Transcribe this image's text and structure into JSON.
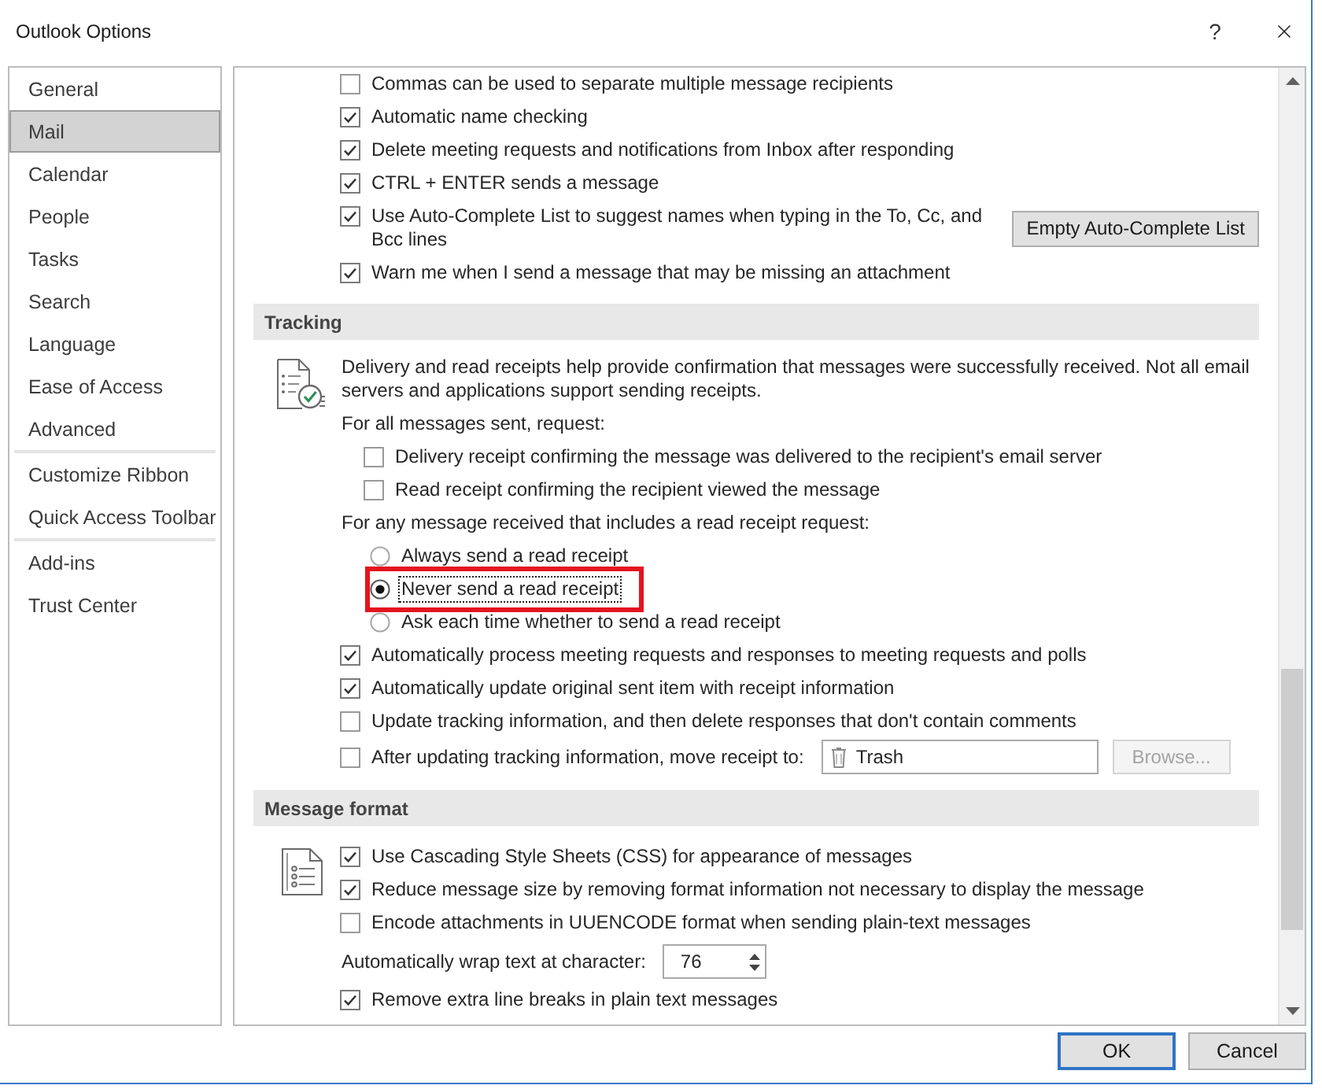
{
  "window": {
    "title": "Outlook Options",
    "help": "?"
  },
  "sidebar": {
    "groups": [
      {
        "items": [
          {
            "label": "General",
            "selected": false
          },
          {
            "label": "Mail",
            "selected": true
          },
          {
            "label": "Calendar",
            "selected": false
          },
          {
            "label": "People",
            "selected": false
          },
          {
            "label": "Tasks",
            "selected": false
          },
          {
            "label": "Search",
            "selected": false
          },
          {
            "label": "Language",
            "selected": false
          },
          {
            "label": "Ease of Access",
            "selected": false
          },
          {
            "label": "Advanced",
            "selected": false
          }
        ]
      },
      {
        "items": [
          {
            "label": "Customize Ribbon",
            "selected": false
          },
          {
            "label": "Quick Access Toolbar",
            "selected": false
          }
        ]
      },
      {
        "items": [
          {
            "label": "Add-ins",
            "selected": false
          },
          {
            "label": "Trust Center",
            "selected": false
          }
        ]
      }
    ]
  },
  "content": {
    "sections": [
      {
        "rows": [
          {
            "kind": "checkbox",
            "label": "Commas can be used to separate multiple message recipients",
            "checked": false
          },
          {
            "kind": "checkbox",
            "label": "Automatic name checking",
            "checked": true
          },
          {
            "kind": "checkbox",
            "label": "Delete meeting requests and notifications from Inbox after responding",
            "checked": true
          },
          {
            "kind": "checkbox",
            "label": "CTRL + ENTER sends a message",
            "checked": true
          },
          {
            "kind": "checkbox",
            "label": "Use Auto-Complete List to suggest names when typing in the To, Cc, and Bcc lines",
            "checked": true,
            "button": {
              "label": "Empty Auto-Complete List",
              "disabled": false
            }
          },
          {
            "kind": "checkbox",
            "label": "Warn me when I send a message that may be missing an attachment",
            "checked": true
          }
        ]
      },
      {
        "title": "Tracking",
        "rows": [
          {
            "kind": "paragraph",
            "text": "Delivery and read receipts help provide confirmation that messages were successfully received. Not all email servers and applications support sending receipts."
          },
          {
            "kind": "group",
            "label": "For all messages sent, request:",
            "children": [
              {
                "kind": "checkbox",
                "label": "Delivery receipt confirming the message was delivered to the recipient's email server",
                "checked": false
              },
              {
                "kind": "checkbox",
                "label": "Read receipt confirming the recipient viewed the message",
                "checked": false
              }
            ]
          },
          {
            "kind": "group",
            "label": "For any message received that includes a read receipt request:",
            "children": [
              {
                "kind": "radio",
                "label": "Always send a read receipt",
                "selected": false,
                "focused": false,
                "highlighted": false
              },
              {
                "kind": "radio",
                "label": "Never send a read receipt",
                "selected": true,
                "focused": true,
                "highlighted": true
              },
              {
                "kind": "radio",
                "label": "Ask each time whether to send a read receipt",
                "selected": false,
                "focused": false,
                "highlighted": false
              }
            ]
          },
          {
            "kind": "checkbox",
            "label": "Automatically process meeting requests and responses to meeting requests and polls",
            "checked": true
          },
          {
            "kind": "checkbox",
            "label": "Automatically update original sent item with receipt information",
            "checked": true
          },
          {
            "kind": "checkbox",
            "label": "Update tracking information, and then delete responses that don't contain comments",
            "checked": false
          },
          {
            "kind": "checkbox",
            "label": "After updating tracking information, move receipt to:",
            "checked": false,
            "folder_field": {
              "value": "Trash"
            },
            "button": {
              "label": "Browse...",
              "disabled": true
            }
          }
        ]
      },
      {
        "title": "Message format",
        "rows": [
          {
            "kind": "checkbox",
            "label": "Use Cascading Style Sheets (CSS) for appearance of messages",
            "checked": true
          },
          {
            "kind": "checkbox",
            "label": "Reduce message size by removing format information not necessary to display the message",
            "checked": true
          },
          {
            "kind": "checkbox",
            "label": "Encode attachments in UUENCODE format when sending plain-text messages",
            "checked": false
          },
          {
            "kind": "spinner",
            "label": "Automatically wrap text at character:",
            "value": "76"
          },
          {
            "kind": "checkbox",
            "label": "Remove extra line breaks in plain text messages",
            "checked": true
          }
        ]
      }
    ]
  },
  "footer": {
    "buttons": [
      {
        "label": "OK",
        "default": true
      },
      {
        "label": "Cancel",
        "default": false
      }
    ]
  }
}
